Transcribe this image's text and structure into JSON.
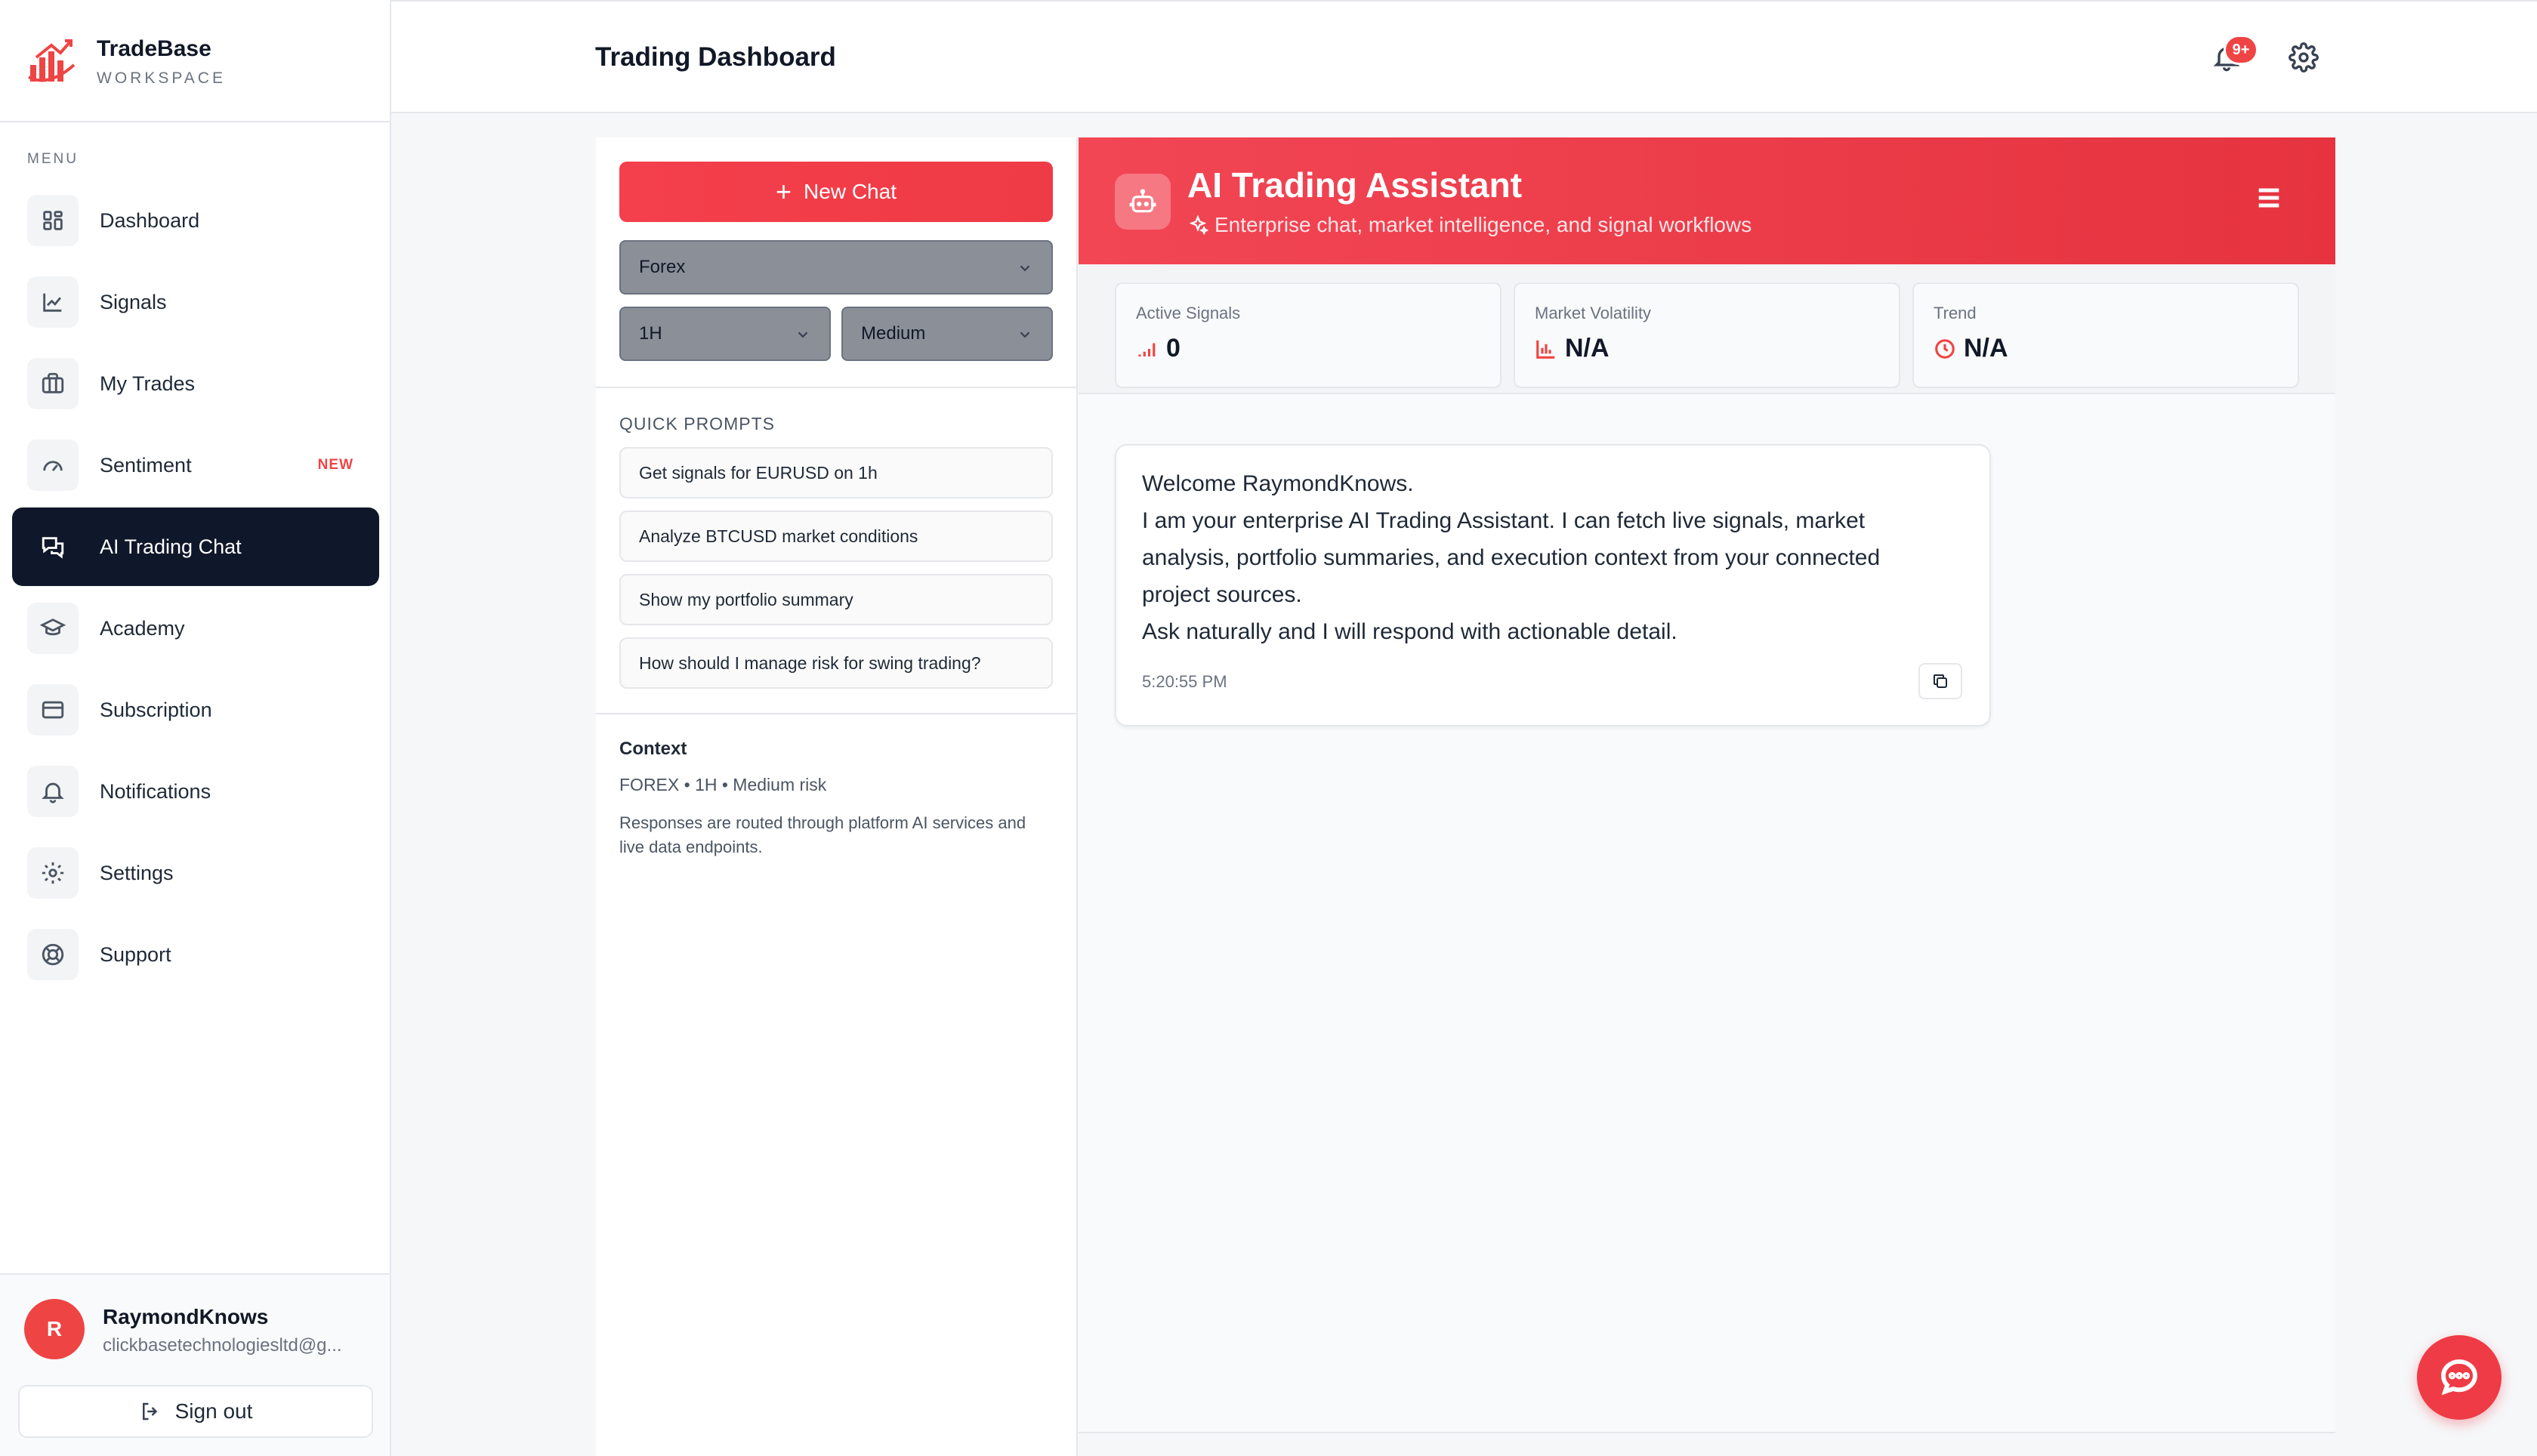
{
  "brand": {
    "name": "TradeBase",
    "subtitle": "WORKSPACE",
    "logo_icon": "tradebase-logo-icon"
  },
  "sidebar": {
    "menu_heading": "MENU",
    "items": [
      {
        "label": "Dashboard",
        "icon": "dashboard-grid-icon",
        "badge": ""
      },
      {
        "label": "Signals",
        "icon": "chart-line-icon",
        "badge": ""
      },
      {
        "label": "My Trades",
        "icon": "briefcase-icon",
        "badge": ""
      },
      {
        "label": "Sentiment",
        "icon": "gauge-icon",
        "badge": "NEW"
      },
      {
        "label": "AI Trading Chat",
        "icon": "chat-bubbles-icon",
        "badge": "",
        "active": true
      },
      {
        "label": "Academy",
        "icon": "graduation-cap-icon",
        "badge": ""
      },
      {
        "label": "Subscription",
        "icon": "credit-card-icon",
        "badge": ""
      },
      {
        "label": "Notifications",
        "icon": "bell-icon",
        "badge": ""
      },
      {
        "label": "Settings",
        "icon": "gear-icon",
        "badge": ""
      },
      {
        "label": "Support",
        "icon": "lifebuoy-icon",
        "badge": ""
      }
    ]
  },
  "user": {
    "initial": "R",
    "name": "RaymondKnows",
    "email": "clickbasetechnologiesltd@g...",
    "signout_label": "Sign out"
  },
  "header": {
    "title": "Trading Dashboard",
    "notification_badge": "9+"
  },
  "chat_panel": {
    "new_chat_label": "New Chat",
    "market_select": "Forex",
    "timeframe_select": "1H",
    "risk_select": "Medium",
    "quick_prompts_heading": "QUICK PROMPTS",
    "quick_prompts": [
      "Get signals for EURUSD on 1h",
      "Analyze BTCUSD market conditions",
      "Show my portfolio summary",
      "How should I manage risk for swing trading?"
    ],
    "context_heading": "Context",
    "context_line": "FOREX • 1H • Medium risk",
    "context_note": "Responses are routed through platform AI services and live data endpoints."
  },
  "assistant": {
    "title": "AI Trading Assistant",
    "subtitle": "Enterprise chat, market intelligence, and signal workflows",
    "stats": [
      {
        "label": "Active Signals",
        "value": "0",
        "icon": "signal-bars-icon"
      },
      {
        "label": "Market Volatility",
        "value": "N/A",
        "icon": "bar-chart-icon"
      },
      {
        "label": "Trend",
        "value": "N/A",
        "icon": "clock-icon"
      }
    ],
    "message": {
      "lines": [
        "Welcome RaymondKnows.",
        "I am your enterprise AI Trading Assistant. I can fetch live signals, market",
        "analysis, portfolio summaries, and execution context from your connected",
        "project sources.",
        "Ask naturally and I will respond with actionable detail."
      ],
      "time": "5:20:55 PM"
    }
  },
  "colors": {
    "accent": "#ef3b45",
    "active_nav": "#0f172a",
    "badge": "#ef4444"
  }
}
